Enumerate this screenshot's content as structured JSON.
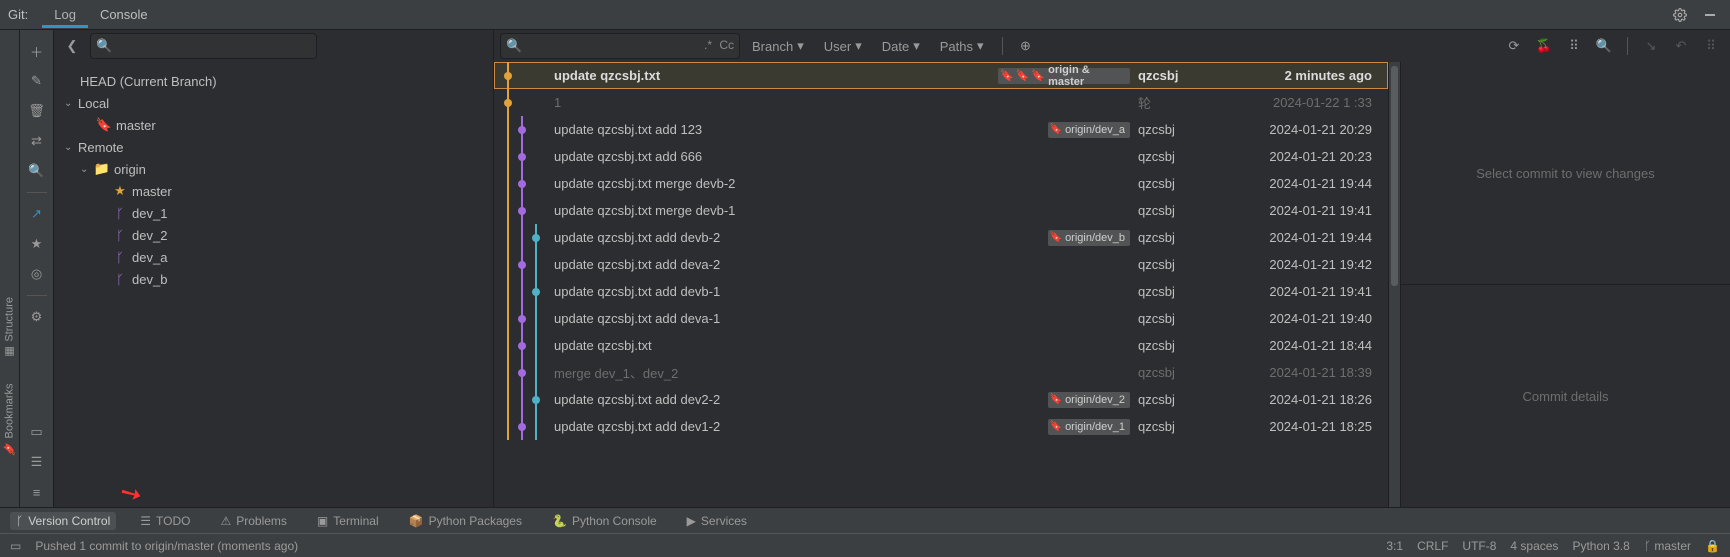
{
  "header": {
    "title": "Git:",
    "tabs": [
      "Log",
      "Console"
    ],
    "active_tab": 0
  },
  "left_side": {
    "labels": [
      "Structure",
      "Bookmarks"
    ]
  },
  "branch_tree": {
    "head_label": "HEAD (Current Branch)",
    "groups": [
      {
        "name": "Local",
        "expanded": true,
        "items": [
          {
            "name": "master",
            "icon": "bookmark",
            "starred": false
          }
        ]
      },
      {
        "name": "Remote",
        "expanded": true,
        "items": [
          {
            "name": "origin",
            "icon": "folder",
            "expandable": true,
            "children": [
              {
                "name": "master",
                "starred": true
              },
              {
                "name": "dev_1"
              },
              {
                "name": "dev_2"
              },
              {
                "name": "dev_a"
              },
              {
                "name": "dev_b"
              }
            ]
          }
        ]
      }
    ]
  },
  "filters": {
    "search_placeholder": "",
    "branch_label": "Branch",
    "user_label": "User",
    "date_label": "Date",
    "paths_label": "Paths"
  },
  "commits": [
    {
      "msg": "update qzcsbj.txt",
      "refs": [
        {
          "text": "origin & master",
          "colors": [
            "#e0a23b",
            "#4caf50",
            "#2196f3"
          ]
        }
      ],
      "author": "qzcsbj",
      "date": "2 minutes ago",
      "lane": 0,
      "nodeColor": "#e0a23b",
      "selected": true
    },
    {
      "msg": "1",
      "refs": [],
      "author": "轮",
      "date": "2024-01-22 1 :33",
      "lane": 0,
      "nodeColor": "#e0a23b",
      "dim": true
    },
    {
      "msg": "update qzcsbj.txt add 123",
      "refs": [
        {
          "text": "origin/dev_a",
          "colors": [
            "#c678dd"
          ]
        }
      ],
      "author": "qzcsbj",
      "date": "2024-01-21 20:29",
      "lane": 1,
      "nodeColor": "#a46be0"
    },
    {
      "msg": "update qzcsbj.txt add 666",
      "refs": [],
      "author": "qzcsbj",
      "date": "2024-01-21 20:23",
      "lane": 1,
      "nodeColor": "#a46be0"
    },
    {
      "msg": "update qzcsbj.txt merge devb-2",
      "refs": [],
      "author": "qzcsbj",
      "date": "2024-01-21 19:44",
      "lane": 1,
      "nodeColor": "#a46be0"
    },
    {
      "msg": "update qzcsbj.txt merge devb-1",
      "refs": [],
      "author": "qzcsbj",
      "date": "2024-01-21 19:41",
      "lane": 1,
      "nodeColor": "#a46be0"
    },
    {
      "msg": "update qzcsbj.txt add devb-2",
      "refs": [
        {
          "text": "origin/dev_b",
          "colors": [
            "#c678dd"
          ]
        }
      ],
      "author": "qzcsbj",
      "date": "2024-01-21 19:44",
      "lane": 2,
      "nodeColor": "#4fb0c6"
    },
    {
      "msg": "update qzcsbj.txt add deva-2",
      "refs": [],
      "author": "qzcsbj",
      "date": "2024-01-21 19:42",
      "lane": 1,
      "nodeColor": "#a46be0"
    },
    {
      "msg": "update qzcsbj.txt add devb-1",
      "refs": [],
      "author": "qzcsbj",
      "date": "2024-01-21 19:41",
      "lane": 2,
      "nodeColor": "#4fb0c6"
    },
    {
      "msg": "update qzcsbj.txt add deva-1",
      "refs": [],
      "author": "qzcsbj",
      "date": "2024-01-21 19:40",
      "lane": 1,
      "nodeColor": "#a46be0"
    },
    {
      "msg": "update qzcsbj.txt",
      "refs": [],
      "author": "qzcsbj",
      "date": "2024-01-21 18:44",
      "lane": 1,
      "nodeColor": "#a46be0"
    },
    {
      "msg": "merge dev_1、dev_2",
      "refs": [],
      "author": "qzcsbj",
      "date": "2024-01-21 18:39",
      "lane": 1,
      "nodeColor": "#a46be0",
      "dim": true
    },
    {
      "msg": "update qzcsbj.txt add dev2-2",
      "refs": [
        {
          "text": "origin/dev_2",
          "colors": [
            "#c678dd"
          ]
        }
      ],
      "author": "qzcsbj",
      "date": "2024-01-21 18:26",
      "lane": 2,
      "nodeColor": "#4fb0c6"
    },
    {
      "msg": "update qzcsbj.txt add dev1-2",
      "refs": [
        {
          "text": "origin/dev_1",
          "colors": [
            "#c678dd"
          ]
        }
      ],
      "author": "qzcsbj",
      "date": "2024-01-21 18:25",
      "lane": 1,
      "nodeColor": "#a46be0"
    }
  ],
  "details": {
    "placeholder_top": "Select commit to view changes",
    "placeholder_bottom": "Commit details"
  },
  "tool_windows": [
    {
      "label": "Version Control",
      "icon": "branch",
      "active": true
    },
    {
      "label": "TODO",
      "icon": "list"
    },
    {
      "label": "Problems",
      "icon": "warn"
    },
    {
      "label": "Terminal",
      "icon": "term"
    },
    {
      "label": "Python Packages",
      "icon": "pkg"
    },
    {
      "label": "Python Console",
      "icon": "py"
    },
    {
      "label": "Services",
      "icon": "play"
    }
  ],
  "status": {
    "msg": "Pushed 1 commit to origin/master (moments ago)",
    "pos": "3:1",
    "eol": "CRLF",
    "enc": "UTF-8",
    "indent": "4 spaces",
    "interp": "Python 3.8",
    "branch": "master"
  },
  "colors": {
    "accent": "#3592c4",
    "select_border": "#d0873f"
  }
}
